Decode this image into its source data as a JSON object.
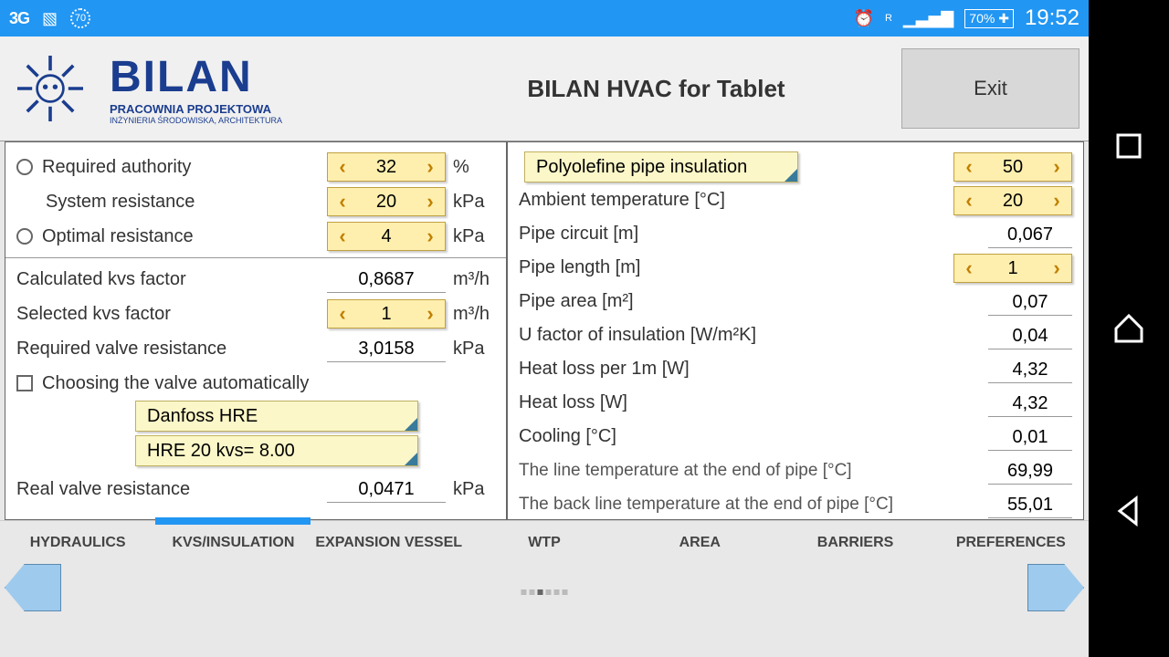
{
  "status": {
    "net": "3G",
    "battery": "70%",
    "time": "19:52",
    "signal_r": "R"
  },
  "header": {
    "brand": "BILAN",
    "sub": "PRACOWNIA PROJEKTOWA",
    "sub2": "INŻYNIERIA ŚRODOWISKA, ARCHITEKTURA",
    "title": "BILAN HVAC for Tablet",
    "exit": "Exit"
  },
  "left": {
    "req_auth": "Required authority",
    "req_auth_val": "32",
    "req_auth_unit": "%",
    "sys_res": "System resistance",
    "sys_res_val": "20",
    "sys_res_unit": "kPa",
    "opt_res": "Optimal resistance",
    "opt_res_val": "4",
    "opt_res_unit": "kPa",
    "calc_kvs": "Calculated kvs factor",
    "calc_kvs_val": "0,8687",
    "calc_kvs_unit": "m³/h",
    "sel_kvs": "Selected kvs factor",
    "sel_kvs_val": "1",
    "sel_kvs_unit": "m³/h",
    "req_valve": "Required valve resistance",
    "req_valve_val": "3,0158",
    "req_valve_unit": "kPa",
    "auto_choose": "Choosing the valve automatically",
    "dd_mfr": "Danfoss HRE",
    "dd_model": "HRE 20 kvs= 8.00",
    "real_valve": "Real valve resistance",
    "real_valve_val": "0,0471",
    "real_valve_unit": "kPa"
  },
  "right": {
    "insul": "Polyolefine pipe insulation",
    "insul_val": "50",
    "amb": "Ambient temperature [°C]",
    "amb_val": "20",
    "circ": "Pipe circuit [m]",
    "circ_val": "0,067",
    "len": "Pipe length [m]",
    "len_val": "1",
    "area": "Pipe area [m²]",
    "area_val": "0,07",
    "ufac": "U factor of insulation [W/m²K]",
    "ufac_val": "0,04",
    "hl1m": "Heat loss per 1m [W]",
    "hl1m_val": "4,32",
    "hl": "Heat loss [W]",
    "hl_val": "4,32",
    "cool": "Cooling [°C]",
    "cool_val": "0,01",
    "line_t": "The line temperature at the end of pipe [°C]",
    "line_t_val": "69,99",
    "back_t": "The back line temperature at the end of pipe [°C]",
    "back_t_val": "55,01"
  },
  "tabs": [
    "HYDRAULICS",
    "KVS/INSULATION",
    "EXPANSION VESSEL",
    "WTP",
    "AREA",
    "BARRIERS",
    "PREFERENCES"
  ]
}
